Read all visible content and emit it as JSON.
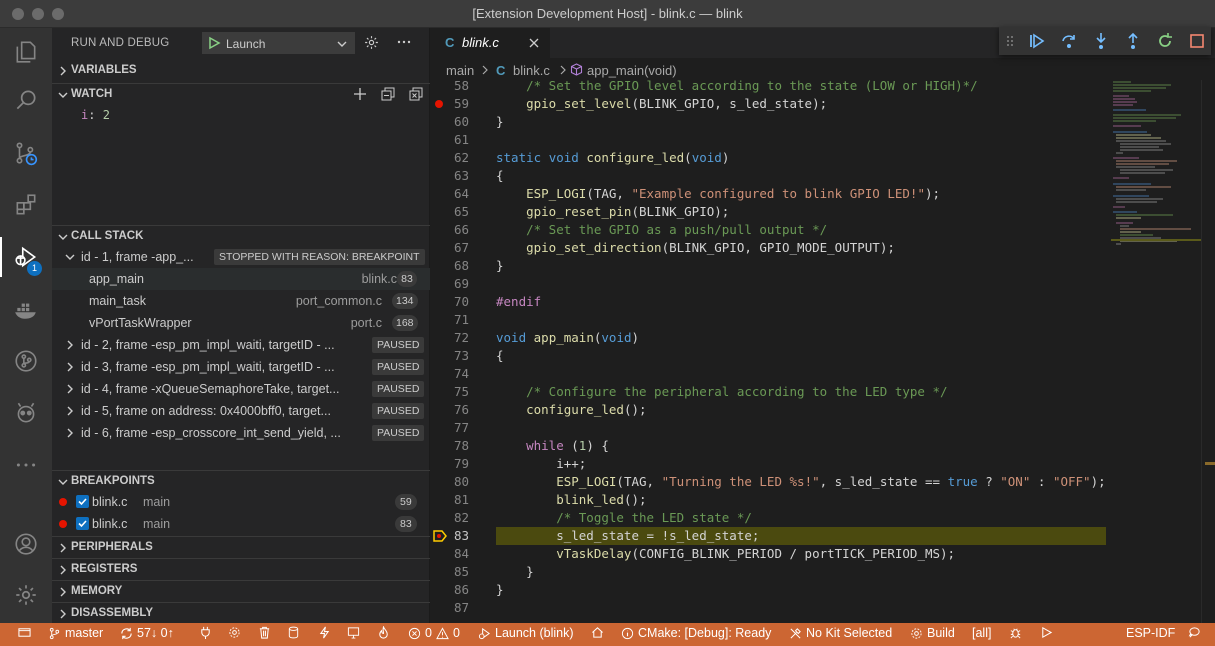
{
  "window": {
    "title": "[Extension Development Host] - blink.c — blink"
  },
  "activity_bar": {
    "debug_badge": "1"
  },
  "sidebar": {
    "title": "RUN AND DEBUG",
    "launch_config": "Launch",
    "sections": {
      "variables": "VARIABLES",
      "watch": "WATCH",
      "call_stack": "CALL STACK",
      "breakpoints": "BREAKPOINTS",
      "peripherals": "PERIPHERALS",
      "registers": "REGISTERS",
      "memory": "MEMORY",
      "disassembly": "DISASSEMBLY"
    },
    "watch_items": [
      {
        "name": "i",
        "value": "2"
      }
    ],
    "call_stack": {
      "threads": [
        {
          "label": "id - 1, frame -app_...",
          "badge": "STOPPED WITH REASON: BREAKPOINT",
          "expanded": true,
          "frames": [
            {
              "fn": "app_main",
              "file": "blink.c",
              "line": "83"
            },
            {
              "fn": "main_task",
              "file": "port_common.c",
              "line": "134"
            },
            {
              "fn": "vPortTaskWrapper",
              "file": "port.c",
              "line": "168"
            }
          ]
        },
        {
          "label": "id - 2, frame -esp_pm_impl_waiti, targetID - ...",
          "badge": "PAUSED"
        },
        {
          "label": "id - 3, frame -esp_pm_impl_waiti, targetID - ...",
          "badge": "PAUSED"
        },
        {
          "label": "id - 4, frame -xQueueSemaphoreTake, target...",
          "badge": "PAUSED"
        },
        {
          "label": "id - 5, frame on address: 0x4000bff0, target...",
          "badge": "PAUSED"
        },
        {
          "label": "id - 6, frame -esp_crosscore_int_send_yield, ...",
          "badge": "PAUSED"
        }
      ]
    },
    "breakpoints": [
      {
        "file": "blink.c",
        "fn": "main",
        "line": "59"
      },
      {
        "file": "blink.c",
        "fn": "main",
        "line": "83"
      }
    ]
  },
  "editor": {
    "tab": {
      "icon": "C",
      "label": "blink.c"
    },
    "breadcrumb": {
      "folder": "main",
      "file_icon": "C",
      "file": "blink.c",
      "symbol": "app_main(void)"
    },
    "current_line": 83,
    "breakpoint_line": 59,
    "lines": [
      {
        "n": "58",
        "tokens": [
          [
            "cmt",
            "    /* Set the GPIO level according to the state (LOW or HIGH)*/"
          ]
        ]
      },
      {
        "n": "59",
        "tokens": [
          [
            "fn",
            "    gpio_set_level"
          ],
          [
            "",
            "(BLINK_GPIO, s_led_state);"
          ]
        ]
      },
      {
        "n": "60",
        "tokens": [
          [
            "",
            "}"
          ]
        ]
      },
      {
        "n": "61",
        "tokens": []
      },
      {
        "n": "62",
        "tokens": [
          [
            "kw",
            "static"
          ],
          [
            "",
            " "
          ],
          [
            "kw",
            "void"
          ],
          [
            "",
            " "
          ],
          [
            "fn",
            "configure_led"
          ],
          [
            "",
            "("
          ],
          [
            "kw",
            "void"
          ],
          [
            "",
            ")"
          ]
        ]
      },
      {
        "n": "63",
        "tokens": [
          [
            "",
            "{"
          ]
        ]
      },
      {
        "n": "64",
        "tokens": [
          [
            "fn",
            "    ESP_LOGI"
          ],
          [
            "",
            "(TAG, "
          ],
          [
            "str",
            "\"Example configured to blink GPIO LED!\""
          ],
          [
            "",
            ");"
          ]
        ]
      },
      {
        "n": "65",
        "tokens": [
          [
            "fn",
            "    gpio_reset_pin"
          ],
          [
            "",
            "(BLINK_GPIO);"
          ]
        ]
      },
      {
        "n": "66",
        "tokens": [
          [
            "cmt",
            "    /* Set the GPIO as a push/pull output */"
          ]
        ]
      },
      {
        "n": "67",
        "tokens": [
          [
            "fn",
            "    gpio_set_direction"
          ],
          [
            "",
            "(BLINK_GPIO, GPIO_MODE_OUTPUT);"
          ]
        ]
      },
      {
        "n": "68",
        "tokens": [
          [
            "",
            "}"
          ]
        ]
      },
      {
        "n": "69",
        "tokens": []
      },
      {
        "n": "70",
        "tokens": [
          [
            "ctl",
            "#endif"
          ]
        ]
      },
      {
        "n": "71",
        "tokens": []
      },
      {
        "n": "72",
        "tokens": [
          [
            "kw",
            "void"
          ],
          [
            "",
            " "
          ],
          [
            "fn",
            "app_main"
          ],
          [
            "",
            "("
          ],
          [
            "kw",
            "void"
          ],
          [
            "",
            ")"
          ]
        ]
      },
      {
        "n": "73",
        "tokens": [
          [
            "",
            "{"
          ]
        ]
      },
      {
        "n": "74",
        "tokens": []
      },
      {
        "n": "75",
        "tokens": [
          [
            "cmt",
            "    /* Configure the peripheral according to the LED type */"
          ]
        ]
      },
      {
        "n": "76",
        "tokens": [
          [
            "fn",
            "    configure_led"
          ],
          [
            "",
            "();"
          ]
        ]
      },
      {
        "n": "77",
        "tokens": []
      },
      {
        "n": "78",
        "tokens": [
          [
            "ctl",
            "    while"
          ],
          [
            "",
            " ("
          ],
          [
            "num",
            "1"
          ],
          [
            "",
            ") {"
          ]
        ]
      },
      {
        "n": "79",
        "tokens": [
          [
            "",
            "        i++;"
          ]
        ]
      },
      {
        "n": "80",
        "tokens": [
          [
            "fn",
            "        ESP_LOGI"
          ],
          [
            "",
            "(TAG, "
          ],
          [
            "str",
            "\"Turning the LED %s!\""
          ],
          [
            "",
            ", s_led_state == "
          ],
          [
            "kw",
            "true"
          ],
          [
            "",
            " ? "
          ],
          [
            "str",
            "\"ON\""
          ],
          [
            "",
            " : "
          ],
          [
            "str",
            "\"OFF\""
          ],
          [
            "",
            ");"
          ]
        ]
      },
      {
        "n": "81",
        "tokens": [
          [
            "fn",
            "        blink_led"
          ],
          [
            "",
            "();"
          ]
        ]
      },
      {
        "n": "82",
        "tokens": [
          [
            "cmt",
            "        /* Toggle the LED state */"
          ]
        ]
      },
      {
        "n": "83",
        "tokens": [
          [
            "",
            "        s_led_state = !s_led_state;"
          ]
        ]
      },
      {
        "n": "84",
        "tokens": [
          [
            "fn",
            "        vTaskDelay"
          ],
          [
            "",
            "(CONFIG_BLINK_PERIOD / portTICK_PERIOD_MS);"
          ]
        ]
      },
      {
        "n": "85",
        "tokens": [
          [
            "",
            "    }"
          ]
        ]
      },
      {
        "n": "86",
        "tokens": [
          [
            "",
            "}"
          ]
        ]
      },
      {
        "n": "87",
        "tokens": []
      }
    ]
  },
  "status_bar": {
    "branch": "master",
    "sync": "57↓ 0↑",
    "problems_errors": "0",
    "problems_warnings": "0",
    "launch": "Launch (blink)",
    "cmake": "CMake: [Debug]: Ready",
    "kit": "No Kit Selected",
    "build": "Build",
    "target": "[all]",
    "esp_idf": "ESP-IDF"
  },
  "colors": {
    "status_bar": "#cc6633",
    "current_line": "#4b4a0f",
    "breakpoint": "#e51400",
    "accent": "#0e70c0"
  }
}
